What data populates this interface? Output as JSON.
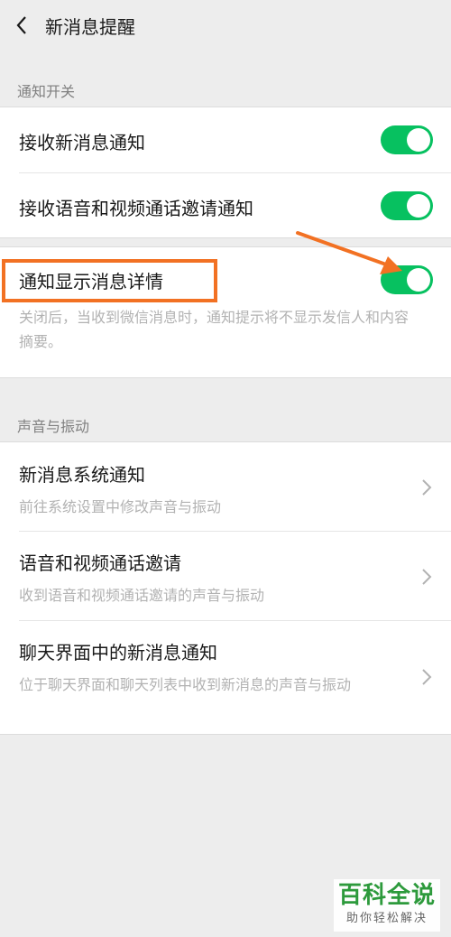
{
  "header": {
    "title": "新消息提醒",
    "back_icon": "chevron-left-icon"
  },
  "notification_section": {
    "label": "通知开关",
    "items": [
      {
        "title": "接收新消息通知",
        "toggle_on": true
      },
      {
        "title": "接收语音和视频通话邀请通知",
        "toggle_on": true
      }
    ],
    "detail_item": {
      "title": "通知显示消息详情",
      "description": "关闭后，当收到微信消息时，通知提示将不显示发信人和内容摘要。",
      "toggle_on": true
    }
  },
  "sound_section": {
    "label": "声音与振动",
    "items": [
      {
        "title": "新消息系统通知",
        "description": "前往系统设置中修改声音与振动"
      },
      {
        "title": "语音和视频通话邀请",
        "description": "收到语音和视频通话邀请的声音与振动"
      },
      {
        "title": "聊天界面中的新消息通知",
        "description": "位于聊天界面和聊天列表中收到新消息的声音与振动"
      }
    ]
  },
  "annotation": {
    "color": "#f27123"
  },
  "watermark": {
    "main": "百科全说",
    "sub": "助你轻松解决"
  },
  "colors": {
    "toggle_on": "#07c160",
    "background": "#ededed",
    "annotation": "#f27123",
    "watermark": "#2d9a3c"
  }
}
